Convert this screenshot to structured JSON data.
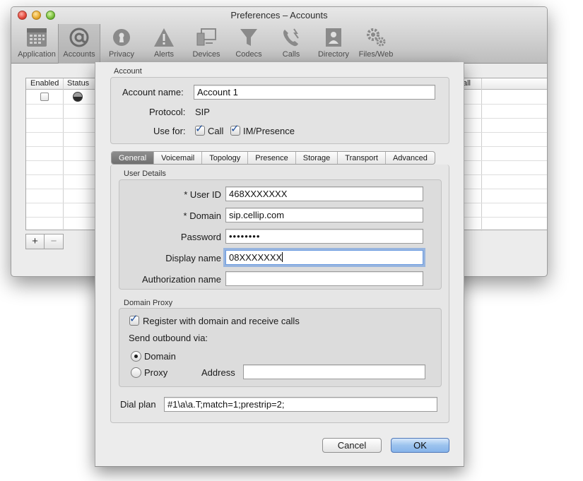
{
  "window": {
    "title": "Preferences – Accounts",
    "toolbar": [
      {
        "label": "Application",
        "icon": "application-grid-icon"
      },
      {
        "label": "Accounts",
        "icon": "at-sign-icon"
      },
      {
        "label": "Privacy",
        "icon": "keyhole-icon"
      },
      {
        "label": "Alerts",
        "icon": "warning-triangle-icon"
      },
      {
        "label": "Devices",
        "icon": "monitor-icon"
      },
      {
        "label": "Codecs",
        "icon": "funnel-icon"
      },
      {
        "label": "Calls",
        "icon": "phone-icon"
      },
      {
        "label": "Directory",
        "icon": "contact-book-icon"
      },
      {
        "label": "Files/Web",
        "icon": "gears-icon"
      }
    ],
    "table": {
      "columns": [
        "Enabled",
        "Status",
        "all"
      ],
      "add_label": "+",
      "remove_label": "−"
    }
  },
  "sheet": {
    "account_group": {
      "title": "Account",
      "account_name_label": "Account name:",
      "account_name_value": "Account 1",
      "protocol_label": "Protocol:",
      "protocol_value": "SIP",
      "use_for_label": "Use for:",
      "use_for_call": "Call",
      "use_for_im": "IM/Presence",
      "call_checked": true,
      "im_checked": true
    },
    "tabs": [
      "General",
      "Voicemail",
      "Topology",
      "Presence",
      "Storage",
      "Transport",
      "Advanced"
    ],
    "selected_tab": "General",
    "user_details": {
      "title": "User Details",
      "user_id_label": "* User ID",
      "user_id_value": "468XXXXXXX",
      "domain_label": "* Domain",
      "domain_value": "sip.cellip.com",
      "password_label": "Password",
      "password_value": "••••••••",
      "display_name_label": "Display name",
      "display_name_value": "08XXXXXXX",
      "authorization_name_label": "Authorization name",
      "authorization_name_value": ""
    },
    "domain_proxy": {
      "title": "Domain Proxy",
      "register_label": "Register with domain and receive calls",
      "register_checked": true,
      "send_outbound_label": "Send outbound via:",
      "domain_option": "Domain",
      "proxy_option": "Proxy",
      "selected_option": "Domain",
      "address_label": "Address",
      "address_value": ""
    },
    "dial_plan_label": "Dial plan",
    "dial_plan_value": "#1\\a\\a.T;match=1;prestrip=2;",
    "cancel_label": "Cancel",
    "ok_label": "OK"
  }
}
